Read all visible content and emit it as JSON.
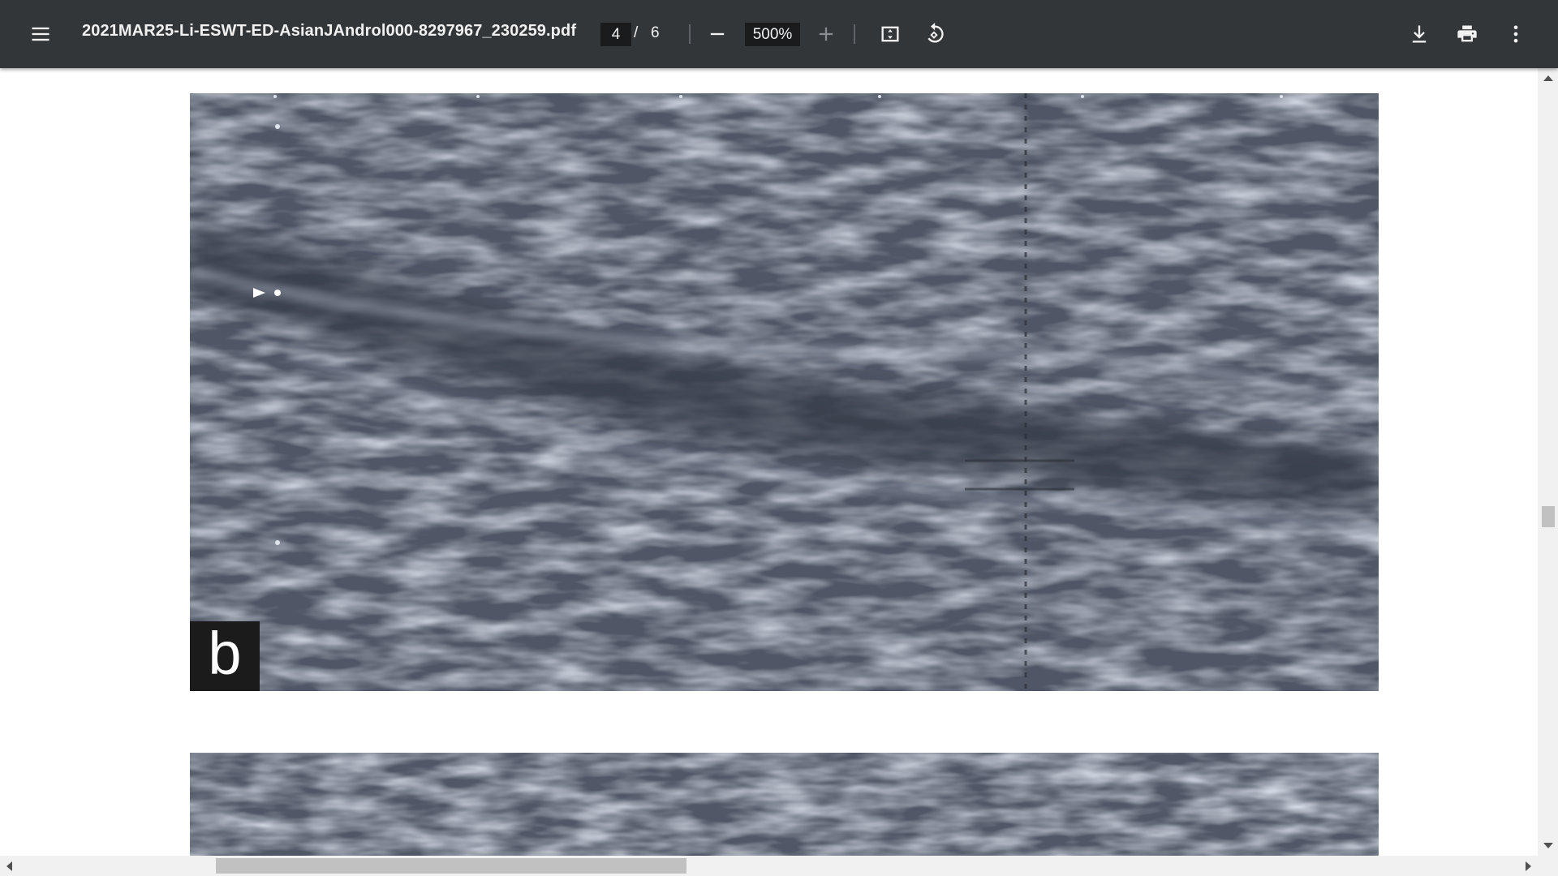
{
  "toolbar": {
    "menu_icon": "hamburger-menu-icon",
    "title": "2021MAR25-Li-ESWT-ED-AsianJAndrol000-8297967_230259.pdf",
    "page_current": "4",
    "page_separator": "/",
    "page_total": "6",
    "zoom_out_icon": "minus-icon",
    "zoom_value": "500%",
    "zoom_in_icon": "plus-icon",
    "fit_icon": "fit-to-page-icon",
    "rotate_icon": "rotate-counterclockwise-icon",
    "download_icon": "download-icon",
    "print_icon": "printer-icon",
    "more_icon": "more-vertical-icon"
  },
  "document": {
    "figure_b_label": "b"
  },
  "colors": {
    "toolbar_bg": "#323639",
    "input_bg": "#191b1c",
    "page_bg": "#ffffff",
    "scrollbar_track": "#f1f1f1",
    "scrollbar_thumb": "#c1c1c1"
  }
}
